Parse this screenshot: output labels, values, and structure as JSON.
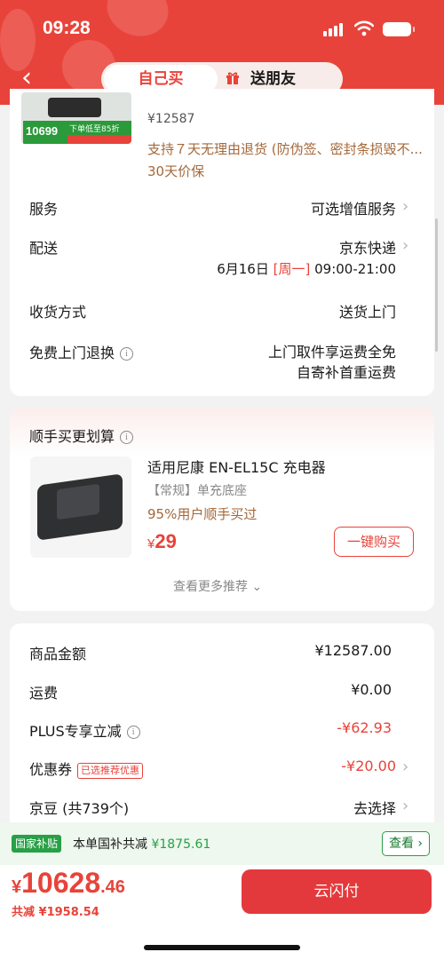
{
  "status_bar": {
    "time": "09:28"
  },
  "header": {
    "tabs": [
      {
        "label": "自己买",
        "active": true
      },
      {
        "label": "送朋友",
        "active": false,
        "icon": "gift-icon"
      }
    ],
    "accent_color": "#e8433a"
  },
  "product": {
    "thumb_price": "10699",
    "thumb_promo": "下单低至85折",
    "price_line": "¥12587",
    "return_note": "支持７天无理由退货 (防伪签、密封条损毁不...",
    "insure_note": "30天价保"
  },
  "rows": {
    "service": {
      "label": "服务",
      "value": "可选增值服务"
    },
    "delivery": {
      "label": "配送",
      "value": "京东快递",
      "date": "6月16日",
      "weekday": "[周一]",
      "time": "09:00-21:00"
    },
    "receive": {
      "label": "收货方式",
      "value": "送货上门"
    },
    "free_return": {
      "label": "免费上门退换",
      "line1": "上门取件享运费全免",
      "line2": "自寄补首重运费"
    }
  },
  "addon": {
    "title": "顺手买更划算",
    "name": "适用尼康 EN-EL15C 充电器",
    "spec": "【常规】单充底座",
    "rate": "95%用户顺手买过",
    "price_symbol": "¥",
    "price": "29",
    "buy_label": "一键购买",
    "more_label": "查看更多推荐 ⌄"
  },
  "summary": {
    "goods": {
      "label": "商品金额",
      "value": "¥12587.00"
    },
    "shipping": {
      "label": "运费",
      "value": "¥0.00"
    },
    "plus": {
      "label": "PLUS专享立减",
      "value": "-¥62.93"
    },
    "coupon": {
      "label": "优惠券",
      "tag": "已选推荐优惠",
      "value": "-¥20.00"
    },
    "beans": {
      "label": "京豆 (共739个)",
      "value": "去选择"
    }
  },
  "subsidy": {
    "tag": "国家补贴",
    "text": "本单国补共减",
    "amount": "¥1875.61",
    "view_label": "查看"
  },
  "checkout": {
    "yen": "¥",
    "total_int": "10628",
    "total_dec": ".46",
    "saved": "共减 ¥1958.54",
    "pay_label": "云闪付"
  }
}
